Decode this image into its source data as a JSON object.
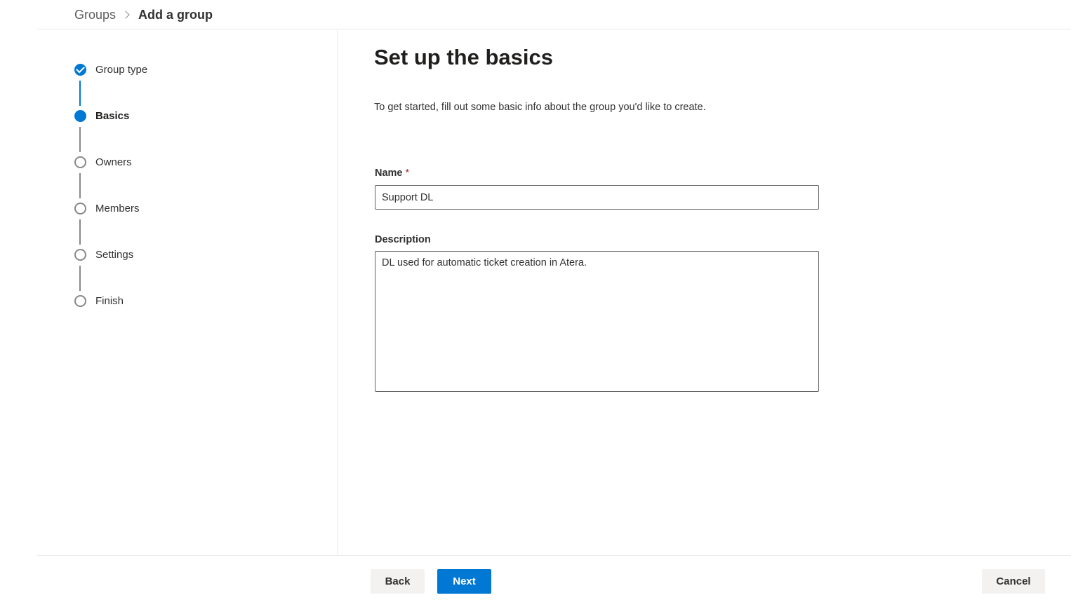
{
  "breadcrumb": {
    "parent": "Groups",
    "current": "Add a group"
  },
  "steps": [
    {
      "label": "Group type",
      "state": "completed"
    },
    {
      "label": "Basics",
      "state": "current"
    },
    {
      "label": "Owners",
      "state": "pending"
    },
    {
      "label": "Members",
      "state": "pending"
    },
    {
      "label": "Settings",
      "state": "pending"
    },
    {
      "label": "Finish",
      "state": "pending"
    }
  ],
  "main": {
    "title": "Set up the basics",
    "intro": "To get started, fill out some basic info about the group you'd like to create.",
    "name_label": "Name",
    "name_required_marker": "*",
    "name_value": "Support DL",
    "description_label": "Description",
    "description_value": "DL used for automatic ticket creation in Atera."
  },
  "footer": {
    "back_label": "Back",
    "next_label": "Next",
    "cancel_label": "Cancel"
  },
  "colors": {
    "accent": "#0078d4",
    "required": "#a4262c"
  },
  "icons": {
    "breadcrumb_separator": "chevron-right-icon",
    "completed_step": "checkmark-circle-icon",
    "current_step": "filled-circle-icon",
    "pending_step": "empty-circle-icon"
  }
}
